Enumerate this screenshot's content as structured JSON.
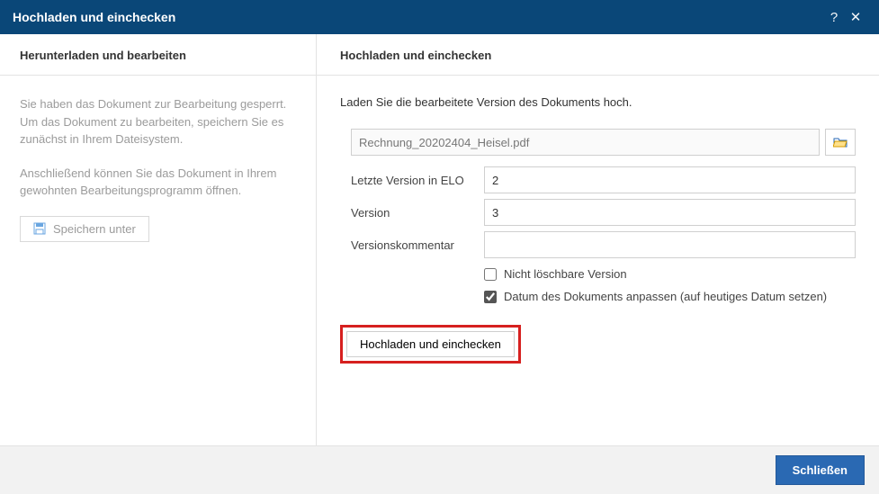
{
  "titlebar": {
    "title": "Hochladen und einchecken"
  },
  "left": {
    "heading": "Herunterladen und bearbeiten",
    "p1": "Sie haben das Dokument zur Bearbeitung gesperrt. Um das Dokument zu bearbeiten, speichern Sie es zunächst in Ihrem Dateisystem.",
    "p2": "Anschließend können Sie das Dokument in Ihrem gewohnten Bearbeitungsprogramm öffnen.",
    "save_label": "Speichern unter"
  },
  "right": {
    "heading": "Hochladen und einchecken",
    "instruction": "Laden Sie die bearbeitete Version des Dokuments hoch.",
    "filename": "Rechnung_20202404_Heisel.pdf",
    "labels": {
      "last_version": "Letzte Version in ELO",
      "version": "Version",
      "comment": "Versionskommentar"
    },
    "values": {
      "last_version": "2",
      "version": "3",
      "comment": ""
    },
    "checkbox1": {
      "label": "Nicht löschbare Version",
      "checked": false
    },
    "checkbox2": {
      "label": "Datum des Dokuments anpassen (auf heutiges Datum setzen)",
      "checked": true
    },
    "upload_label": "Hochladen und einchecken"
  },
  "footer": {
    "close_label": "Schließen"
  }
}
